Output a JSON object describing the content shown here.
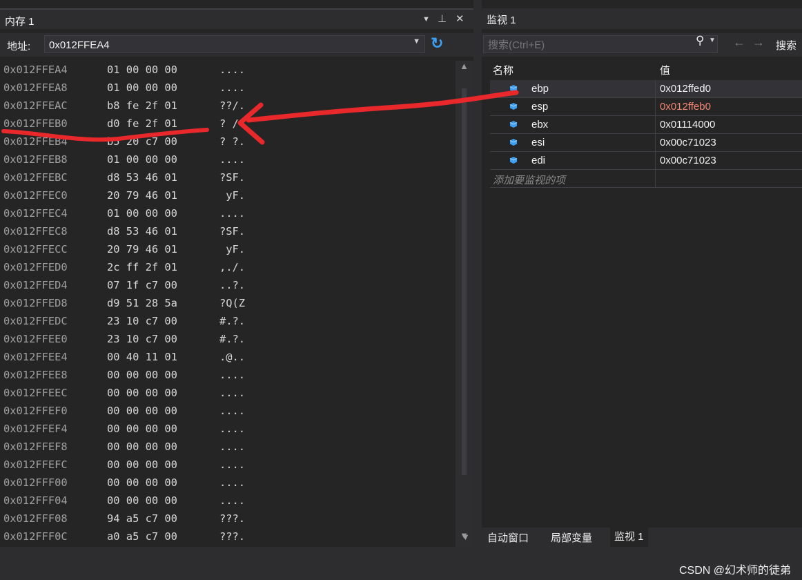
{
  "memory_window": {
    "title": "内存 1",
    "address_label": "地址:",
    "address_value": "0x012FFEA4",
    "rows": [
      {
        "addr": "0x012FFEA4",
        "hex": "01 00 00 00",
        "ascii": "...."
      },
      {
        "addr": "0x012FFEA8",
        "hex": "01 00 00 00",
        "ascii": "...."
      },
      {
        "addr": "0x012FFEAC",
        "hex": "b8 fe 2f 01",
        "ascii": "??/."
      },
      {
        "addr": "0x012FFEB0",
        "hex": "d0 fe 2f 01",
        "ascii": "? /."
      },
      {
        "addr": "0x012FFEB4",
        "hex": "b5 20 c7 00",
        "ascii": "? ?."
      },
      {
        "addr": "0x012FFEB8",
        "hex": "01 00 00 00",
        "ascii": "...."
      },
      {
        "addr": "0x012FFEBC",
        "hex": "d8 53 46 01",
        "ascii": "?SF."
      },
      {
        "addr": "0x012FFEC0",
        "hex": "20 79 46 01",
        "ascii": " yF."
      },
      {
        "addr": "0x012FFEC4",
        "hex": "01 00 00 00",
        "ascii": "...."
      },
      {
        "addr": "0x012FFEC8",
        "hex": "d8 53 46 01",
        "ascii": "?SF."
      },
      {
        "addr": "0x012FFECC",
        "hex": "20 79 46 01",
        "ascii": " yF."
      },
      {
        "addr": "0x012FFED0",
        "hex": "2c ff 2f 01",
        "ascii": ",./."
      },
      {
        "addr": "0x012FFED4",
        "hex": "07 1f c7 00",
        "ascii": "..?."
      },
      {
        "addr": "0x012FFED8",
        "hex": "d9 51 28 5a",
        "ascii": "?Q(Z"
      },
      {
        "addr": "0x012FFEDC",
        "hex": "23 10 c7 00",
        "ascii": "#.?."
      },
      {
        "addr": "0x012FFEE0",
        "hex": "23 10 c7 00",
        "ascii": "#.?."
      },
      {
        "addr": "0x012FFEE4",
        "hex": "00 40 11 01",
        "ascii": ".@.."
      },
      {
        "addr": "0x012FFEE8",
        "hex": "00 00 00 00",
        "ascii": "...."
      },
      {
        "addr": "0x012FFEEC",
        "hex": "00 00 00 00",
        "ascii": "...."
      },
      {
        "addr": "0x012FFEF0",
        "hex": "00 00 00 00",
        "ascii": "...."
      },
      {
        "addr": "0x012FFEF4",
        "hex": "00 00 00 00",
        "ascii": "...."
      },
      {
        "addr": "0x012FFEF8",
        "hex": "00 00 00 00",
        "ascii": "...."
      },
      {
        "addr": "0x012FFEFC",
        "hex": "00 00 00 00",
        "ascii": "...."
      },
      {
        "addr": "0x012FFF00",
        "hex": "00 00 00 00",
        "ascii": "...."
      },
      {
        "addr": "0x012FFF04",
        "hex": "00 00 00 00",
        "ascii": "...."
      },
      {
        "addr": "0x012FFF08",
        "hex": "94 a5 c7 00",
        "ascii": "???."
      },
      {
        "addr": "0x012FFF0C",
        "hex": "a0 a5 c7 00",
        "ascii": "???."
      }
    ]
  },
  "watch_window": {
    "title": "监视 1",
    "search_placeholder": "搜索(Ctrl+E)",
    "search_depth_label": "搜索",
    "col_name": "名称",
    "col_value": "值",
    "rows": [
      {
        "name": "ebp",
        "value": "0x012ffed0",
        "changed": false
      },
      {
        "name": "esp",
        "value": "0x012ffeb0",
        "changed": true
      },
      {
        "name": "ebx",
        "value": "0x01114000",
        "changed": false
      },
      {
        "name": "esi",
        "value": "0x00c71023",
        "changed": false
      },
      {
        "name": "edi",
        "value": "0x00c71023",
        "changed": false
      }
    ],
    "add_item_text": "添加要监视的项",
    "tabs": [
      "自动窗口",
      "局部变量",
      "监视 1"
    ]
  },
  "watermark": "CSDN @幻术师的徒弟",
  "colors": {
    "annotation": "#e8282b",
    "changed_value": "#f48771",
    "accent": "#3ea0f2"
  },
  "icons": {
    "pin": "pin-icon",
    "close": "close-icon",
    "refresh": "refresh-icon",
    "search": "search-icon",
    "register": "register-variable-icon"
  }
}
